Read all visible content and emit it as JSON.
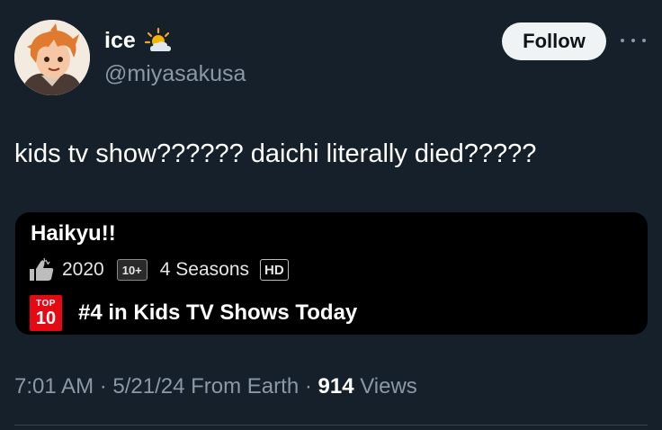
{
  "author": {
    "display_name": "ice",
    "handle": "@miyasakusa",
    "name_emoji": "sun-behind-cloud-icon"
  },
  "follow_button": {
    "label": "Follow"
  },
  "more_menu": {
    "icon": "more-horizontal-icon"
  },
  "tweet": {
    "text": "kids tv show?????? daichi literally died?????"
  },
  "card": {
    "title": "Haikyu!!",
    "year": "2020",
    "maturity_rating": "10+",
    "seasons": "4 Seasons",
    "quality": "HD",
    "top10_badge": {
      "top": "TOP",
      "number": "10"
    },
    "rank_text": "#4 in Kids TV Shows Today",
    "colors": {
      "badge_red": "#e50914",
      "card_bg": "#000000"
    }
  },
  "footer": {
    "time": "7:01 AM",
    "sep1": " · ",
    "date": "5/21/24",
    "source": " From Earth",
    "sep2": " · ",
    "views_count": "914",
    "views_label": " Views"
  },
  "theme": {
    "background": "#15202b",
    "muted_text": "#8b98a5",
    "text": "#ffffff"
  }
}
